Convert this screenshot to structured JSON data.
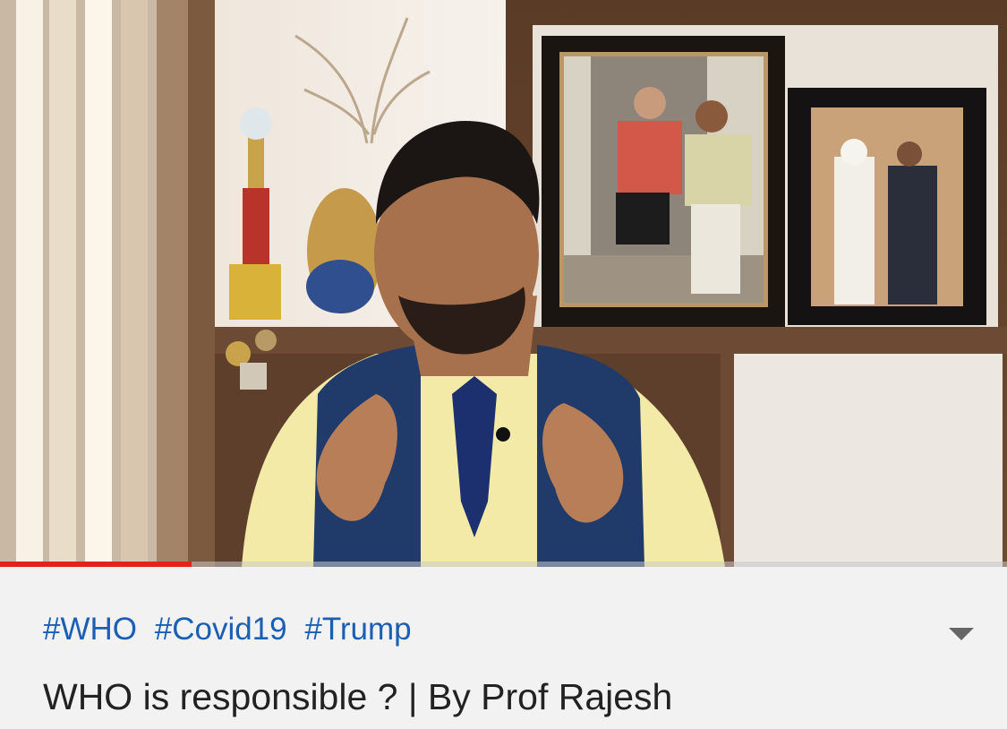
{
  "video": {
    "progress_fraction": 0.19,
    "progress_color": "#e32219"
  },
  "details": {
    "hashtags": [
      "#WHO",
      "#Covid19",
      "#Trump"
    ],
    "hashtag_color": "#1a5fb4",
    "title": "WHO is responsible ? | By Prof Rajesh",
    "expand_icon": "chevron-down-icon"
  }
}
